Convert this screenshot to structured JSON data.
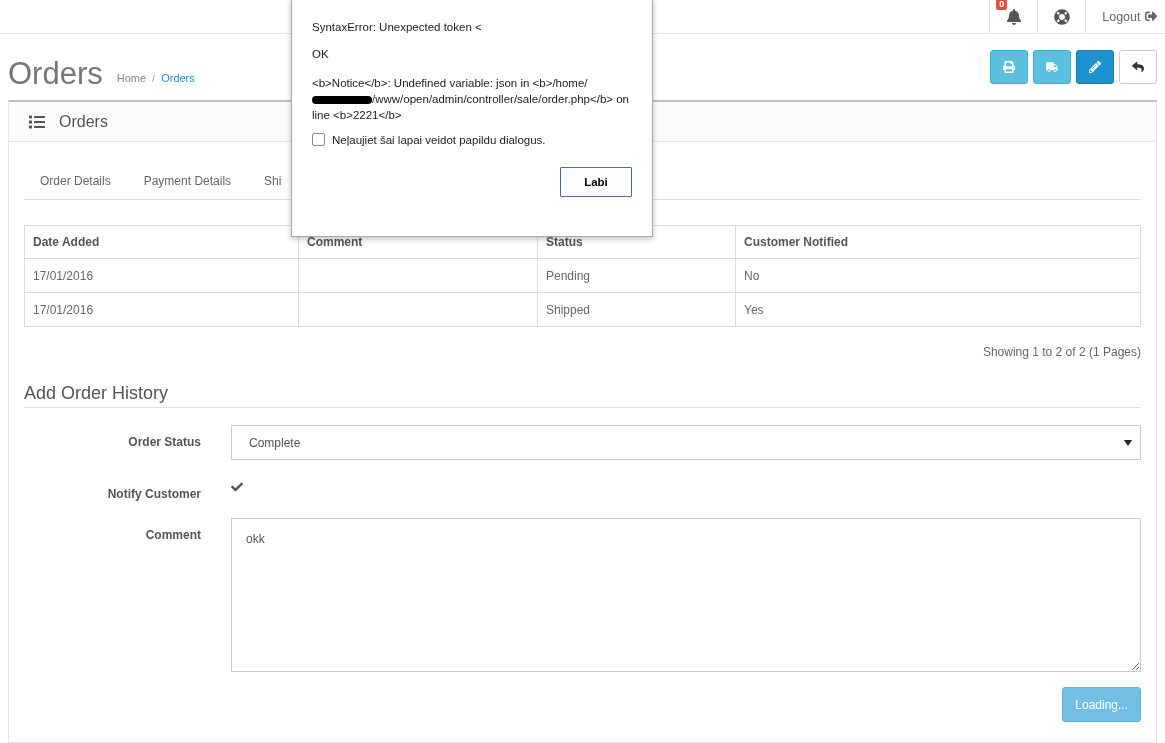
{
  "header": {
    "notifications_count": "0",
    "logout": "Logout"
  },
  "page": {
    "title": "Orders",
    "breadcrumb_separator": "/",
    "breadcrumb": [
      {
        "label": "Home",
        "selected": false
      },
      {
        "label": "Orders",
        "selected": true
      }
    ]
  },
  "toolbar": [
    {
      "kind": "print"
    },
    {
      "kind": "truck"
    },
    {
      "kind": "edit"
    },
    {
      "kind": "back"
    }
  ],
  "panel": {
    "title": "Orders"
  },
  "tabs": [
    {
      "label": "Order Details",
      "selected": false
    },
    {
      "label": "Payment Details",
      "selected": false
    },
    {
      "label": "Shi",
      "selected": false
    }
  ],
  "history_table": {
    "columns": [
      "Date Added",
      "Comment",
      "Status",
      "Customer Notified"
    ],
    "rows": [
      [
        "17/01/2016",
        "",
        "Pending",
        "No"
      ],
      [
        "17/01/2016",
        "",
        "Shipped",
        "Yes"
      ]
    ]
  },
  "pagination": "Showing 1 to 2 of 2 (1 Pages)",
  "add_history": {
    "title": "Add Order History",
    "order_status": {
      "label": "Order Status",
      "value": "Complete"
    },
    "notify": {
      "label": "Notify Customer",
      "checked": true
    },
    "comment": {
      "label": "Comment",
      "value": "okk"
    },
    "button": "Loading..."
  },
  "dialog": {
    "lines": [
      "SyntaxError: Unexpected token <",
      "OK"
    ],
    "notice_before": "<b>Notice</b>: Undefined variable: json in <b>/home/",
    "notice_after": "/www/open/admin/controller/sale/order.php</b> on line <b>2221</b>",
    "suppress": {
      "label": "Neļaujiet šai lapai veidot papildu dialogus.",
      "checked": false
    },
    "button": "Labi"
  }
}
